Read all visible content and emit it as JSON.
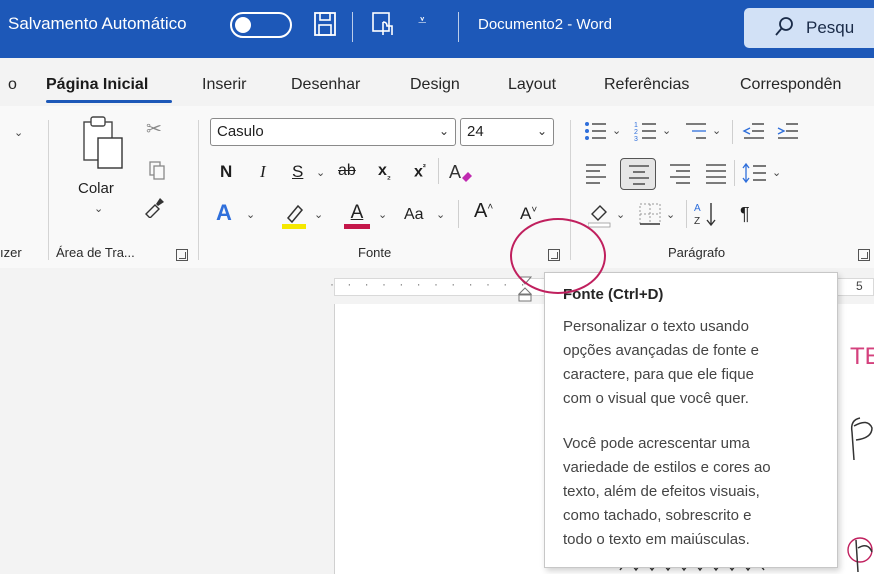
{
  "titlebar": {
    "autosave_label": "Salvamento Automático",
    "doc_title": "Documento2 - Word",
    "search_label": "Pesqu"
  },
  "tabs": [
    {
      "label": "o"
    },
    {
      "label": "Página Inicial"
    },
    {
      "label": "Inserir"
    },
    {
      "label": "Desenhar"
    },
    {
      "label": "Design"
    },
    {
      "label": "Layout"
    },
    {
      "label": "Referências"
    },
    {
      "label": "Correspondên"
    }
  ],
  "ribbon": {
    "clipboard": {
      "paste_label": "Colar",
      "group_label": "Área de Tra...",
      "prev_group_label": "ızer"
    },
    "font": {
      "font_name": "Casulo",
      "font_size": "24",
      "bold": "N",
      "italic": "I",
      "underline": "S",
      "strike": "ab",
      "subscript": "x",
      "superscript": "x",
      "change_case": "Aa",
      "grow": "A",
      "shrink": "A",
      "group_label": "Fonte"
    },
    "paragraph": {
      "group_label": "Parágrafo",
      "pilcrow": "¶"
    }
  },
  "ruler": {
    "ticks": "· · · · · · · · · · · ·",
    "marker": "5"
  },
  "page": {
    "te": "TE"
  },
  "tooltip": {
    "title": "Fonte (Ctrl+D)",
    "para1": [
      "Personalizar o texto usando",
      "opções avançadas de fonte e",
      "caractere, para que ele fique",
      "com o visual que você quer."
    ],
    "para2": [
      "Você pode acrescentar uma",
      "variedade de estilos e cores ao",
      "texto, além de efeitos visuais,",
      "como tachado, sobrescrito e",
      "todo o texto em maiúsculas."
    ]
  },
  "colors": {
    "titlebar_bg": "#1d58b8",
    "highlight_yellow": "#f5e800",
    "font_color_red": "#c4174a",
    "text_effects_blue": "#2f6fdb",
    "annotation_circle": "#c0205e"
  }
}
